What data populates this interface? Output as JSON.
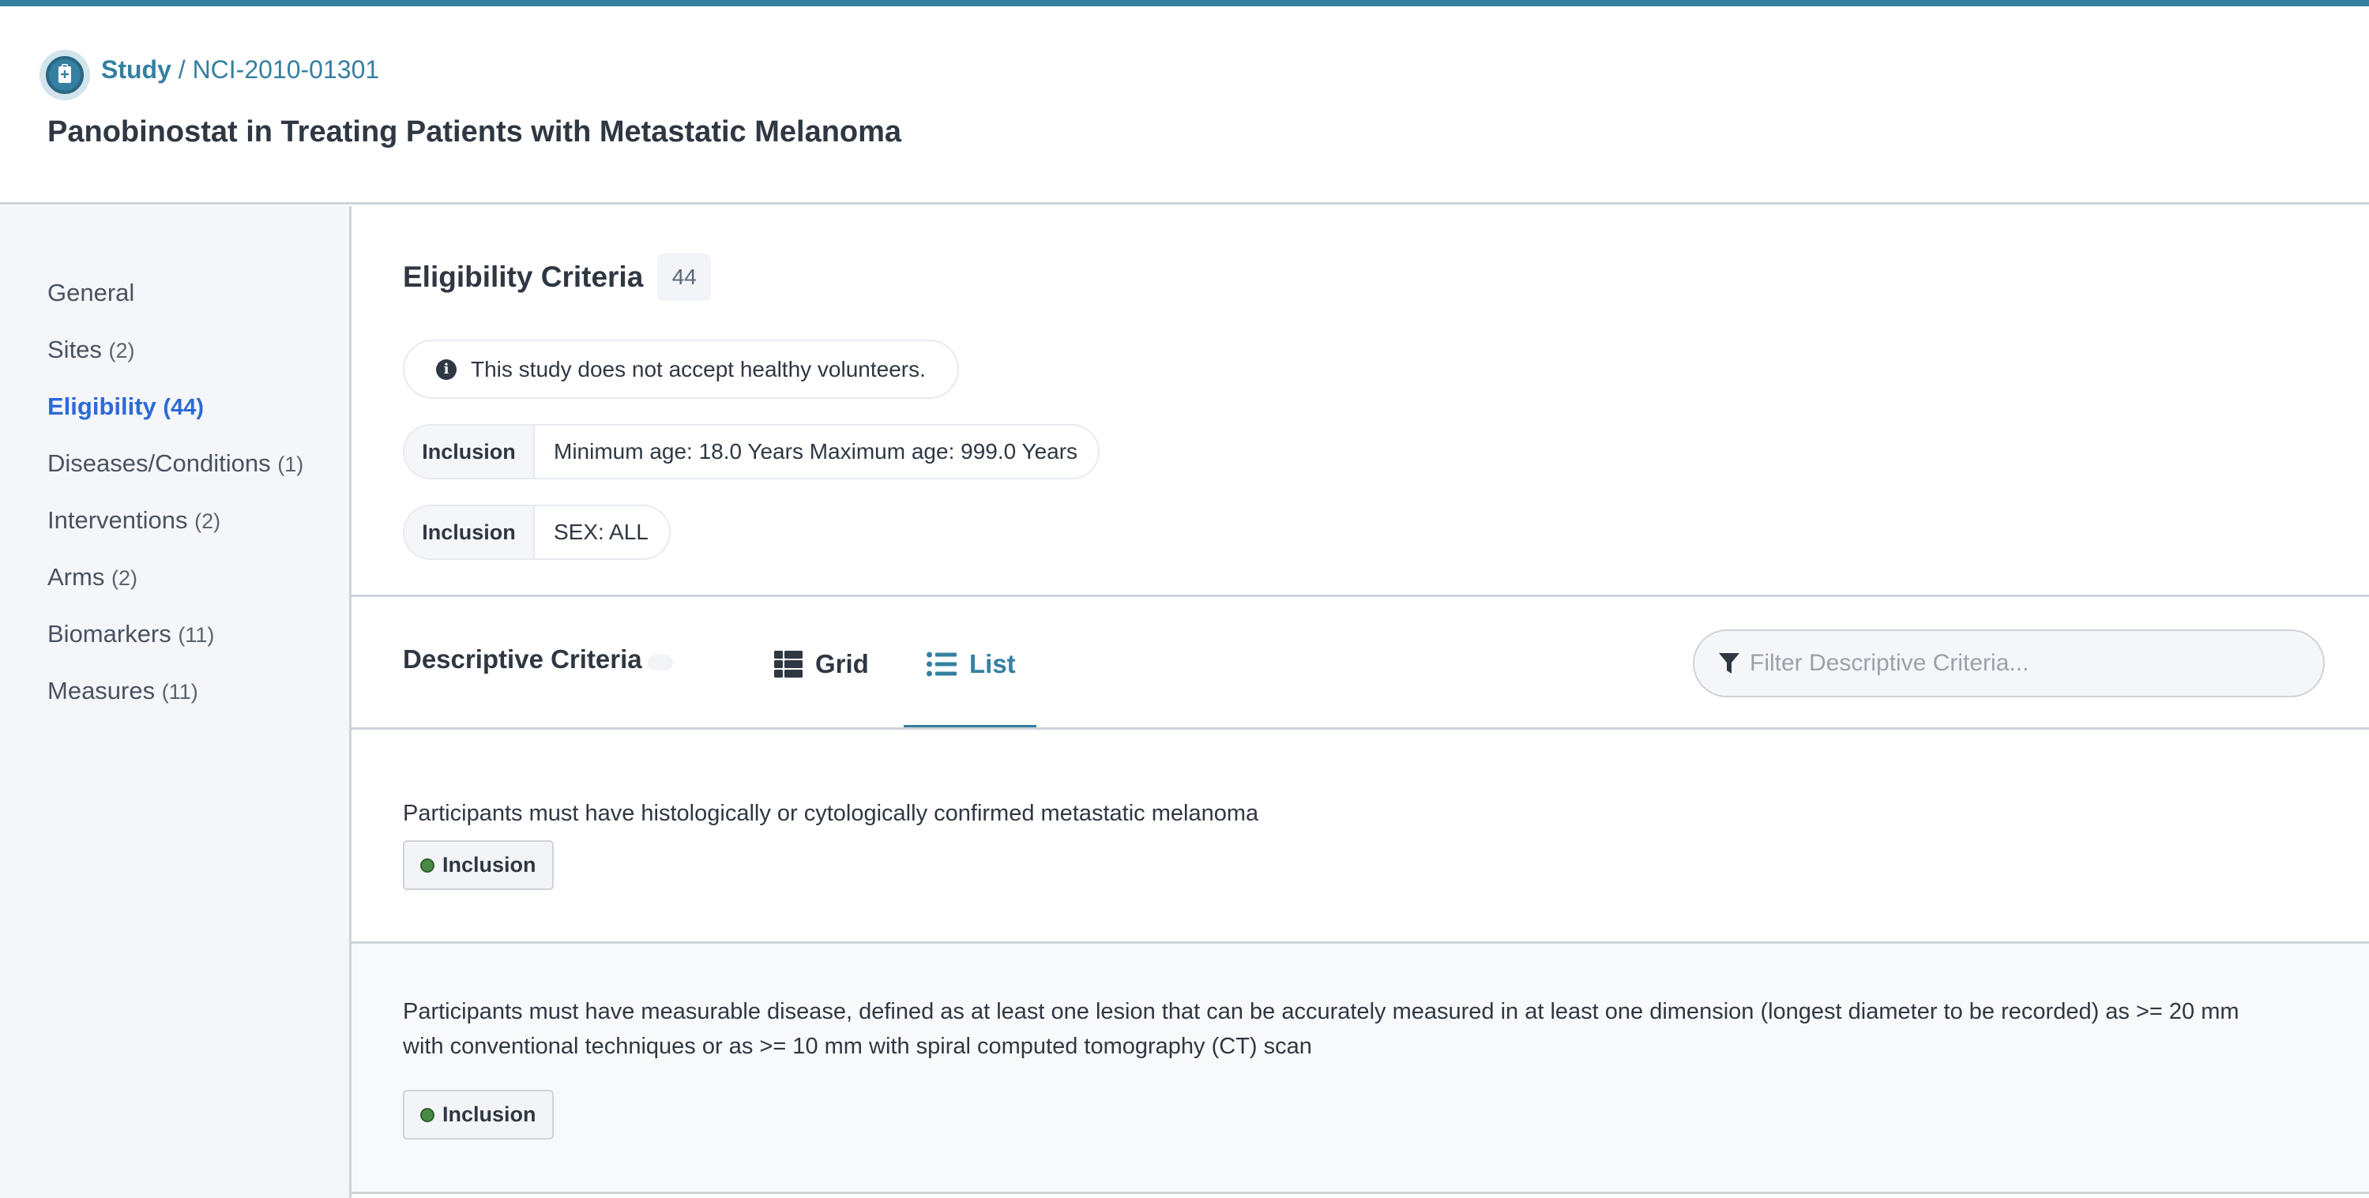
{
  "header": {
    "breadcrumb_root": "Study",
    "breadcrumb_sep": " / ",
    "breadcrumb_id": "NCI-2010-01301",
    "title": "Panobinostat in Treating Patients with Metastatic Melanoma",
    "accent_color": "#357fa0"
  },
  "sidebar": {
    "items": [
      {
        "label": "General",
        "count": ""
      },
      {
        "label": "Sites",
        "count": "(2)"
      },
      {
        "label": "Eligibility",
        "count": "(44)",
        "active": true
      },
      {
        "label": "Diseases/Conditions",
        "count": "(1)"
      },
      {
        "label": "Interventions",
        "count": "(2)"
      },
      {
        "label": "Arms",
        "count": "(2)"
      },
      {
        "label": "Biomarkers",
        "count": "(11)"
      },
      {
        "label": "Measures",
        "count": "(11)"
      }
    ],
    "active_color": "#2c6ad6"
  },
  "eligibility": {
    "title": "Eligibility Criteria",
    "count": "44",
    "info_icon": "info-circle-icon",
    "healthy_volunteers_note": "This study does not accept healthy volunteers.",
    "structured": [
      {
        "type": "Inclusion",
        "value": "Minimum age: 18.0 Years Maximum age: 999.0 Years"
      },
      {
        "type": "Inclusion",
        "value": "SEX: ALL"
      }
    ]
  },
  "descriptive": {
    "title": "Descriptive Criteria",
    "count": "",
    "tabs": [
      {
        "label": "Grid",
        "icon": "grid-icon",
        "active": false
      },
      {
        "label": "List",
        "icon": "list-icon",
        "active": true
      }
    ],
    "filter": {
      "icon": "filter-icon",
      "placeholder": "Filter Descriptive Criteria...",
      "value": ""
    },
    "criteria": [
      {
        "text": "Participants must have histologically or cytologically confirmed metastatic melanoma",
        "type": "Inclusion"
      },
      {
        "text": "Participants must have measurable disease, defined as at least one lesion that can be accurately measured in at least one dimension (longest diameter to be recorded) as >= 20 mm with conventional techniques or as >= 10 mm with spiral computed tomography (CT) scan",
        "type": "Inclusion"
      }
    ],
    "inclusion_color": "#4a8a45"
  }
}
